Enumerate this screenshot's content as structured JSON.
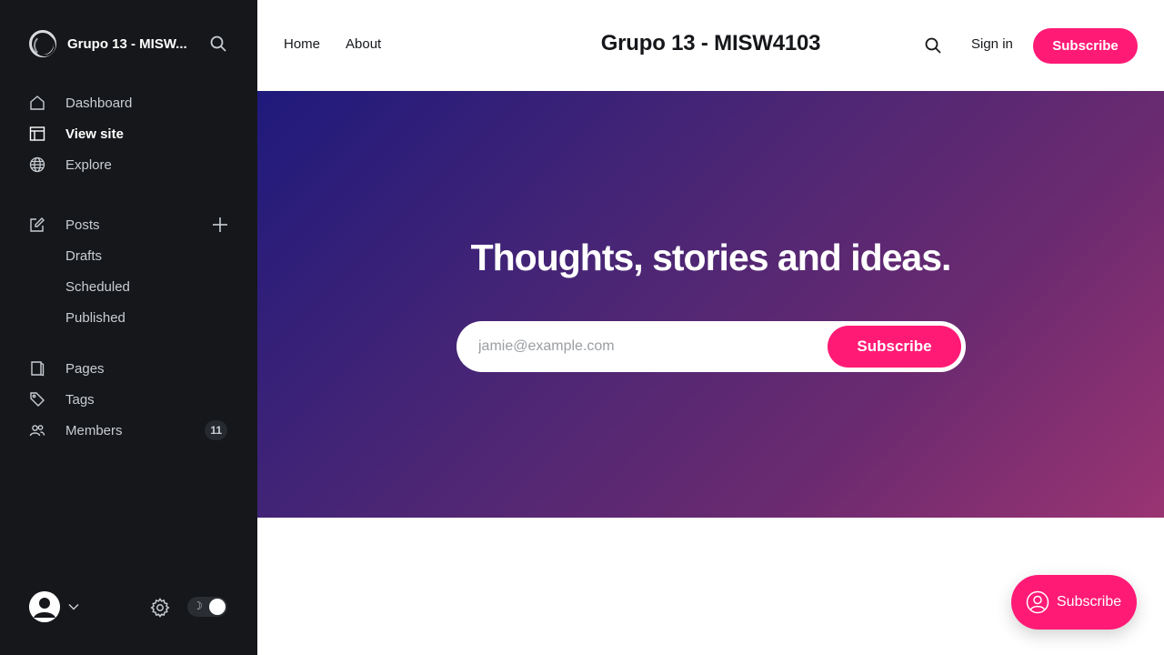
{
  "sidebar": {
    "brand_title": "Grupo 13 - MISW...",
    "nav": {
      "dashboard": "Dashboard",
      "view_site": "View site",
      "explore": "Explore",
      "posts": "Posts",
      "drafts": "Drafts",
      "scheduled": "Scheduled",
      "published": "Published",
      "pages": "Pages",
      "tags": "Tags",
      "members": "Members",
      "members_count": "11"
    },
    "toggle_moon": "☽"
  },
  "header": {
    "nav": {
      "home": "Home",
      "about": "About"
    },
    "site_title": "Grupo 13 - MISW4103",
    "signin": "Sign in",
    "subscribe": "Subscribe"
  },
  "hero": {
    "title": "Thoughts, stories and ideas.",
    "email_placeholder": "jamie@example.com",
    "subscribe": "Subscribe"
  },
  "portal": {
    "label": "Subscribe"
  },
  "colors": {
    "accent": "#ff1a75",
    "sidebar_bg": "#15171a",
    "hero_gradient_start": "#1f1a7c",
    "hero_gradient_end": "#9a3472"
  }
}
